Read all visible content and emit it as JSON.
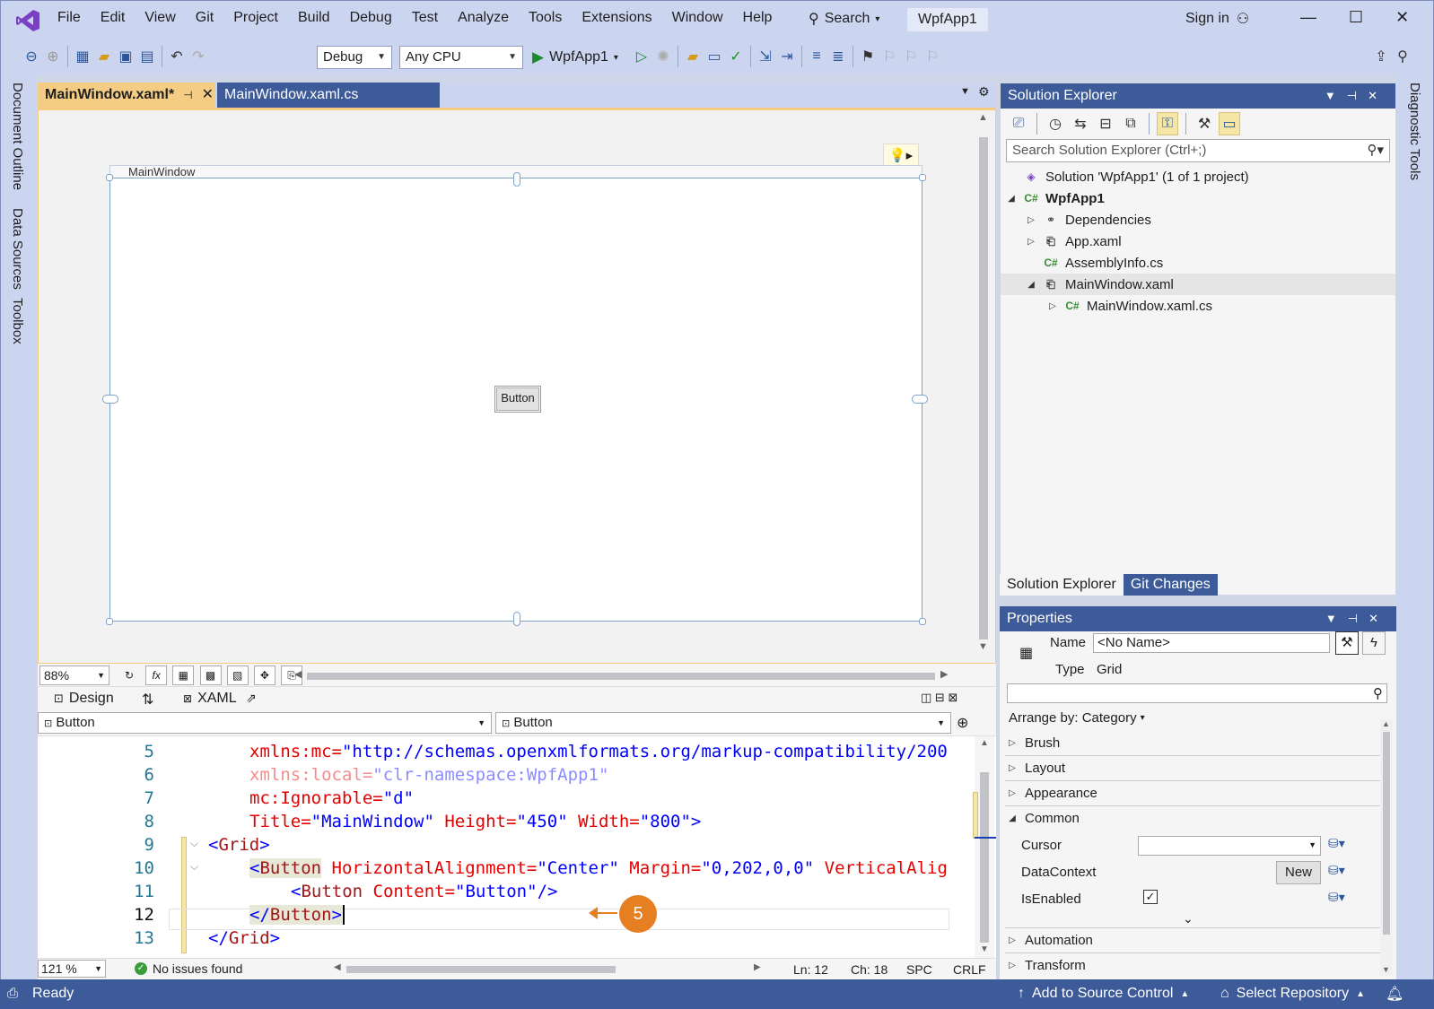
{
  "menu": [
    "File",
    "Edit",
    "View",
    "Git",
    "Project",
    "Build",
    "Debug",
    "Test",
    "Analyze",
    "Tools",
    "Extensions",
    "Window",
    "Help"
  ],
  "search_label": "Search",
  "project_title": "WpfApp1",
  "signin_label": "Sign in",
  "toolbar": {
    "config": "Debug",
    "platform": "Any CPU",
    "run_target": "WpfApp1"
  },
  "left_tabs": [
    "Document Outline",
    "Data Sources",
    "Toolbox"
  ],
  "right_tabs": [
    "Diagnostic Tools"
  ],
  "doc_tabs": [
    {
      "label": "MainWindow.xaml*",
      "active": true
    },
    {
      "label": "MainWindow.xaml.cs",
      "active": false
    }
  ],
  "designer": {
    "window_caption": "MainWindow",
    "button_text": "Button",
    "zoom": "88%"
  },
  "split_tabs": {
    "design": "Design",
    "xaml": "XAML"
  },
  "nav": {
    "left": "Button",
    "right": "Button"
  },
  "code_lines": [
    {
      "num": "5"
    },
    {
      "num": "6"
    },
    {
      "num": "7"
    },
    {
      "num": "8"
    },
    {
      "num": "9"
    },
    {
      "num": "10"
    },
    {
      "num": "11"
    },
    {
      "num": "12"
    },
    {
      "num": "13"
    }
  ],
  "code": {
    "l5_prefix": "xmlns",
    "l5_ns": ":mc=",
    "l5_val": "\"http://schemas.openxmlformats.org/markup-compatibility/200",
    "l6_prefix": "xmlns",
    "l6_ns": ":local=",
    "l6_val": "\"clr-namespace:WpfApp1\"",
    "l7_attr": "mc:Ignorable=",
    "l7_val": "\"d\"",
    "l8_a1": "Title=",
    "l8_v1": "\"MainWindow\"",
    "l8_a2": " Height=",
    "l8_v2": "\"450\"",
    "l8_a3": " Width=",
    "l8_v3": "\"800\"",
    "l8_end": ">",
    "l9_open": "<",
    "l9_tag": "Grid",
    "l9_close": ">",
    "l10_open": "<",
    "l10_tag": "Button",
    "l10_a1": " HorizontalAlignment=",
    "l10_v1": "\"Center\"",
    "l10_a2": " Margin=",
    "l10_v2": "\"0,202,0,0\"",
    "l10_a3": " VerticalAlig",
    "l11_open": "<",
    "l11_tag": "Button",
    "l11_a1": " Content=",
    "l11_v1": "\"Button\"",
    "l11_close": "/>",
    "l12_open": "</",
    "l12_tag": "Button",
    "l12_close": ">",
    "l13_open": "</",
    "l13_tag": "Grid",
    "l13_close": ">"
  },
  "callout_number": "5",
  "editor_status": {
    "zoom": "121 %",
    "issues": "No issues found",
    "ln": "Ln: 12",
    "ch": "Ch: 18",
    "spc": "SPC",
    "crlf": "CRLF"
  },
  "solution_explorer": {
    "title": "Solution Explorer",
    "search_placeholder": "Search Solution Explorer (Ctrl+;)",
    "items": [
      {
        "label": "Solution 'WpfApp1' (1 of 1 project)"
      },
      {
        "label": "WpfApp1"
      },
      {
        "label": "Dependencies"
      },
      {
        "label": "App.xaml"
      },
      {
        "label": "AssemblyInfo.cs"
      },
      {
        "label": "MainWindow.xaml"
      },
      {
        "label": "MainWindow.xaml.cs"
      }
    ],
    "tabs": [
      "Solution Explorer",
      "Git Changes"
    ]
  },
  "properties": {
    "title": "Properties",
    "name_label": "Name",
    "name_value": "<No Name>",
    "type_label": "Type",
    "type_value": "Grid",
    "arrange": "Arrange by: Category",
    "categories": [
      "Brush",
      "Layout",
      "Appearance",
      "Common",
      "Automation",
      "Transform"
    ],
    "rows": [
      {
        "label": "Cursor"
      },
      {
        "label": "DataContext",
        "button": "New"
      },
      {
        "label": "IsEnabled",
        "checked": true
      }
    ]
  },
  "statusbar": {
    "ready": "Ready",
    "source_control": "Add to Source Control",
    "repository": "Select Repository"
  },
  "colors": {
    "accent": "#3d5a99",
    "active_tab": "#f5cc84",
    "chrome": "#ccd5f0",
    "callout": "#e67e22"
  }
}
